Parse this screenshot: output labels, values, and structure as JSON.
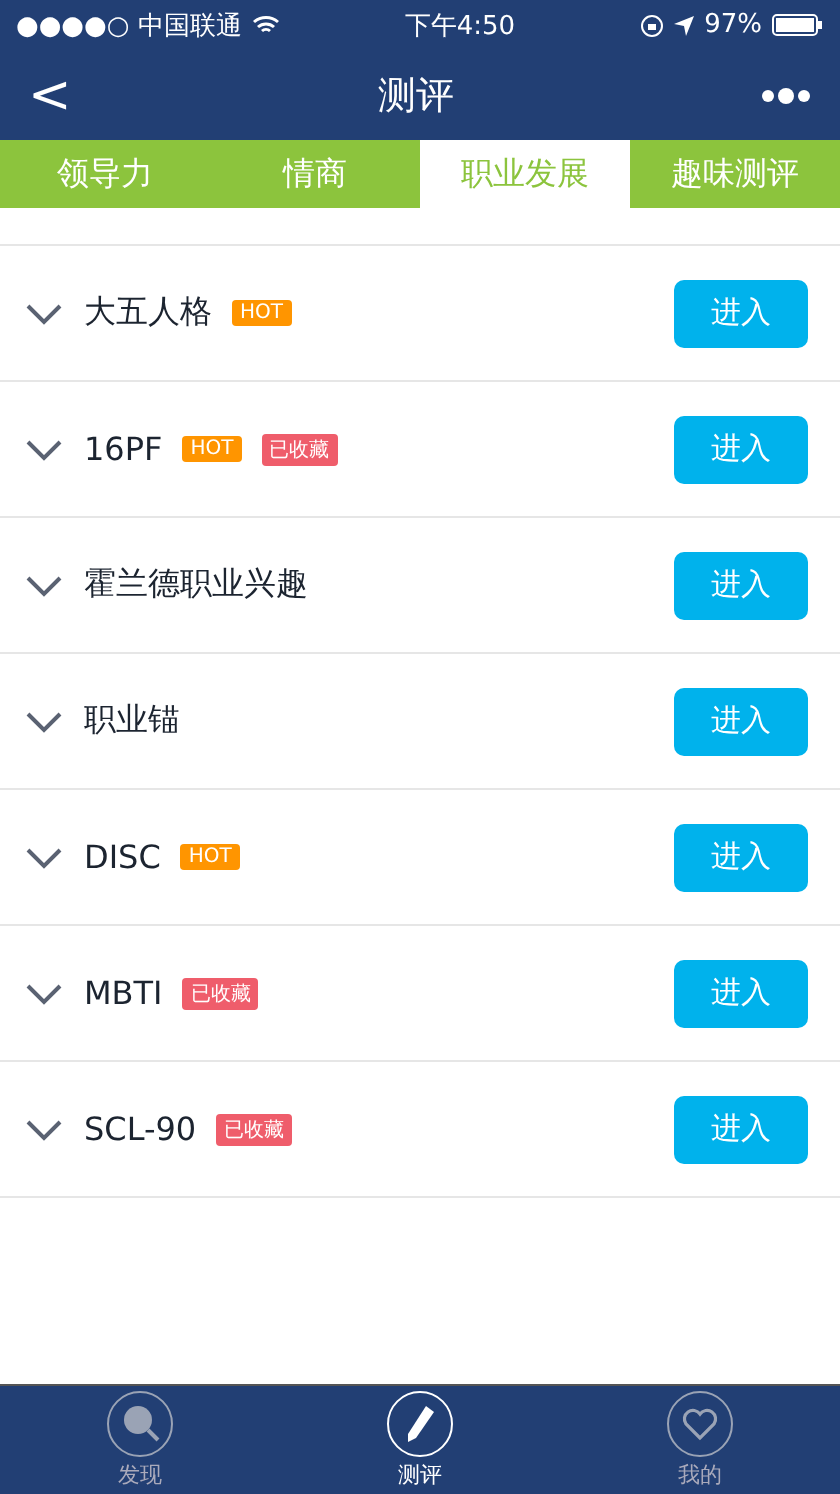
{
  "status_bar": {
    "carrier": "●●●●○ 中国联通",
    "time": "下午4:50",
    "battery": "97%"
  },
  "nav_bar": {
    "back": "<",
    "title": "测评"
  },
  "tabs": [
    {
      "label": "领导力",
      "selected": false
    },
    {
      "label": "情商",
      "selected": false
    },
    {
      "label": "职业发展",
      "selected": true
    },
    {
      "label": "趣味测评",
      "selected": false
    }
  ],
  "tests": [
    {
      "name": "大五人格",
      "tags": [
        {
          "label": "HOT",
          "kind": "hot"
        }
      ],
      "button": "进入"
    },
    {
      "name": "16PF",
      "tags": [
        {
          "label": "HOT",
          "kind": "hot"
        },
        {
          "label": "已收藏",
          "kind": "saved"
        }
      ],
      "button": "进入"
    },
    {
      "name": "霍兰德职业兴趣",
      "button": "进入"
    },
    {
      "name": "职业锚",
      "button": "进入"
    },
    {
      "name": "DISC",
      "tags": [
        {
          "label": "HOT",
          "kind": "hot"
        }
      ],
      "button": "进入"
    },
    {
      "name": "MBTI",
      "tags": [
        {
          "label": "已收藏",
          "kind": "saved"
        }
      ],
      "button": "进入"
    },
    {
      "name": "SCL-90",
      "tags": [
        {
          "label": "已收藏",
          "kind": "saved"
        }
      ],
      "button": "进入"
    }
  ],
  "tab_bar": [
    {
      "label": "发现",
      "kind": "search",
      "selected": false
    },
    {
      "label": "测评",
      "kind": "pen",
      "selected": true
    },
    {
      "label": "我的",
      "kind": "heart",
      "selected": false
    }
  ]
}
